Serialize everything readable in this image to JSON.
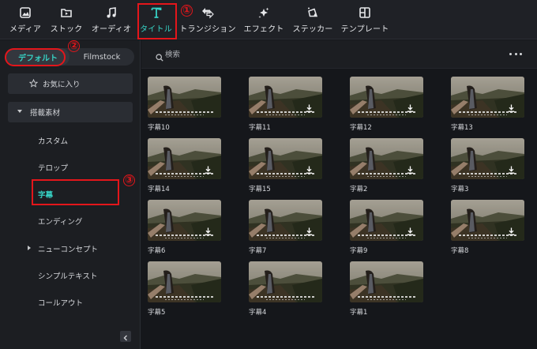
{
  "toolbar": {
    "tools": [
      {
        "label": "メディア",
        "icon": "media-icon"
      },
      {
        "label": "ストック",
        "icon": "stock-icon"
      },
      {
        "label": "オーディオ",
        "icon": "music-note-icon"
      },
      {
        "label": "タイトル",
        "icon": "text-t-icon"
      },
      {
        "label": "トランジション",
        "icon": "transition-arrows-icon"
      },
      {
        "label": "エフェクト",
        "icon": "sparkle-icon"
      },
      {
        "label": "ステッカー",
        "icon": "sticker-icon"
      },
      {
        "label": "テンプレート",
        "icon": "template-icon"
      }
    ],
    "active_index": 3
  },
  "annotations": [
    "①",
    "②",
    "③"
  ],
  "sidebar": {
    "tabs": [
      "デフォルト",
      "Filmstock"
    ],
    "active_tab": "デフォルト",
    "favorites": "お気に入り",
    "group": "搭載素材",
    "items": [
      "カスタム",
      "テロップ",
      "字幕",
      "エンディング",
      "ニューコンセプト",
      "シンプルテキスト",
      "コールアウト"
    ],
    "active_item": "字幕"
  },
  "search": {
    "placeholder": "検索",
    "value": ""
  },
  "grid": [
    {
      "label": "字幕10",
      "download": false
    },
    {
      "label": "字幕11",
      "download": true
    },
    {
      "label": "字幕12",
      "download": true
    },
    {
      "label": "字幕13",
      "download": true
    },
    {
      "label": "字幕14",
      "download": true
    },
    {
      "label": "字幕15",
      "download": true
    },
    {
      "label": "字幕2",
      "download": true
    },
    {
      "label": "字幕3",
      "download": true
    },
    {
      "label": "字幕6",
      "download": true
    },
    {
      "label": "字幕7",
      "download": true
    },
    {
      "label": "字幕9",
      "download": true
    },
    {
      "label": "字幕8",
      "download": true
    },
    {
      "label": "字幕5",
      "download": false
    },
    {
      "label": "字幕4",
      "download": false
    },
    {
      "label": "字幕1",
      "download": false
    }
  ],
  "colors": {
    "accent": "#36d0c3",
    "annotation": "#e4161b",
    "background": "#15171b",
    "panel": "#1c1e22"
  }
}
